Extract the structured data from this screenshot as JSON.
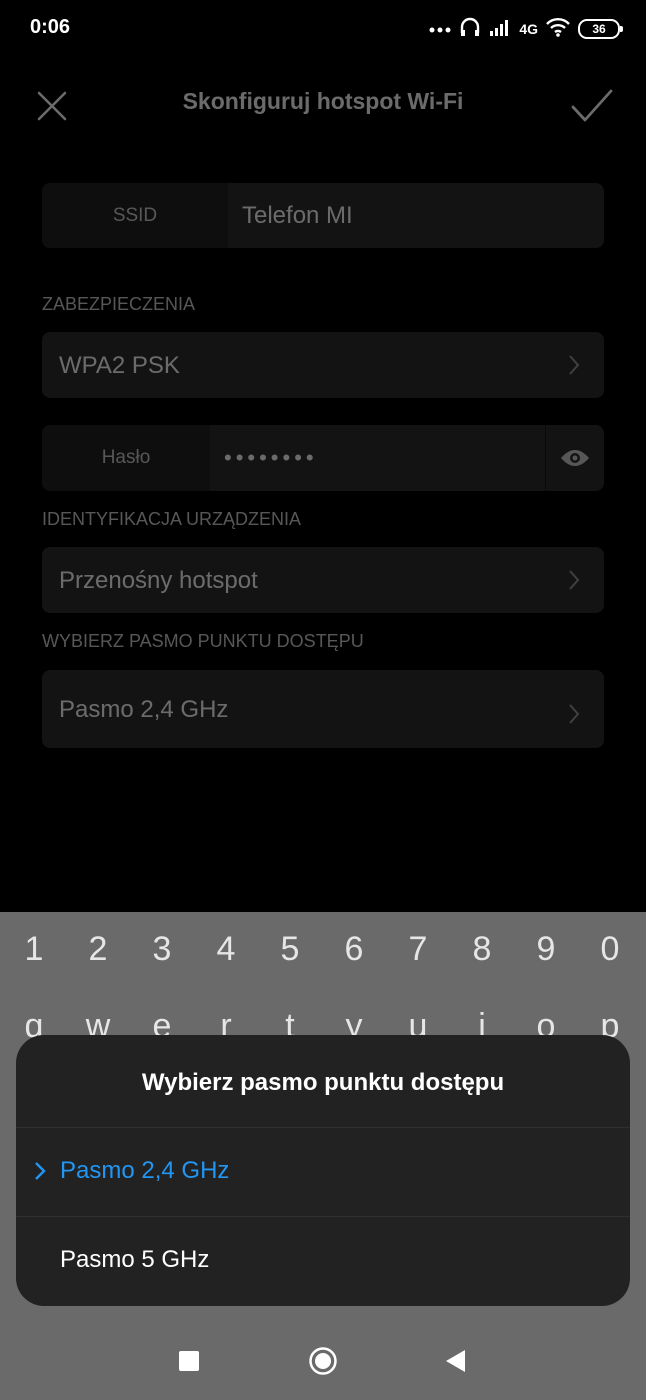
{
  "status_bar": {
    "time": "0:06",
    "network": "4G",
    "battery": "36"
  },
  "header": {
    "title": "Skonfiguruj hotspot Wi-Fi",
    "close_icon": "close-icon",
    "confirm_icon": "check-icon"
  },
  "form": {
    "ssid": {
      "label": "SSID",
      "value": "Telefon MI"
    },
    "security_section": "ZABEZPIECZENIA",
    "security_value": "WPA2 PSK",
    "password": {
      "label": "Hasło",
      "value": "••••••••",
      "toggle_icon": "eye-icon"
    },
    "device_id_section": "IDENTYFIKACJA URZĄDZENIA",
    "device_id_value": "Przenośny hotspot",
    "band_section": "WYBIERZ PASMO PUNKTU DOSTĘPU",
    "band_value": "Pasmo 2,4 GHz"
  },
  "keyboard": {
    "numbers": [
      "1",
      "2",
      "3",
      "4",
      "5",
      "6",
      "7",
      "8",
      "9",
      "0"
    ],
    "letters": [
      "q",
      "w",
      "e",
      "r",
      "t",
      "y",
      "u",
      "i",
      "o",
      "p"
    ]
  },
  "dialog": {
    "title": "Wybierz pasmo punktu dostępu",
    "options": [
      {
        "label": "Pasmo 2,4 GHz",
        "selected": true
      },
      {
        "label": "Pasmo 5 GHz",
        "selected": false
      }
    ],
    "accent_color": "#2196f3"
  },
  "nav_bar": {
    "recents_icon": "square-icon",
    "home_icon": "circle-icon",
    "back_icon": "triangle-back-icon"
  }
}
